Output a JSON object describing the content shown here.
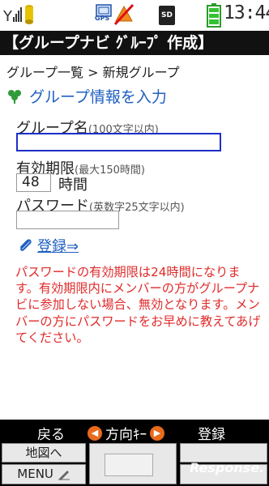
{
  "status_bar": {
    "gps_label": "GPS",
    "sd_label": "SD",
    "time": "13:44",
    "icons": [
      "signal-icon",
      "sub-display-icon",
      "gps-icon",
      "no-entry-icon",
      "sd-card-icon",
      "battery-icon"
    ]
  },
  "title": "【グループナビ ｸﾞﾙｰﾌﾟ 作成】",
  "breadcrumb": "グループ一覧 > 新規グループ",
  "section_title": "グループ情報を入力",
  "form": {
    "group_name_label": "グループ名",
    "group_name_hint": "(100文字以内)",
    "group_name_value": "",
    "validity_label": "有効期限",
    "validity_hint": "(最大150時間)",
    "validity_value": "48",
    "validity_unit": "時間",
    "password_label": "パスワード",
    "password_hint": "(英数字25文字以内)",
    "password_value": ""
  },
  "register_link": "登録⇒",
  "notice": "パスワードの有効期限は24時間になります。有効期限内にメンバーの方がグループナビに参加しない場合、無効となります。メンバーの方にパスワードをお早めに教えてあげてください。",
  "softkeys": {
    "left": "戻る",
    "center": "方向ｷｰ",
    "center_left_glyph": "◀",
    "center_right_glyph": "▶",
    "right": "登録"
  },
  "bottom_menu": {
    "map": "地図へ",
    "menu": "MENU"
  },
  "watermark": "Response."
}
